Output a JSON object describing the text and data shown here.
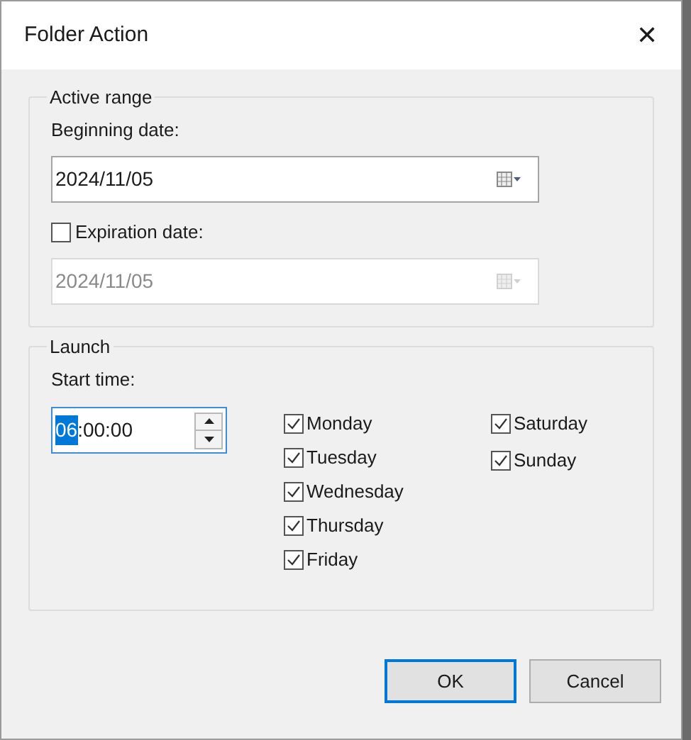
{
  "window": {
    "title": "Folder Action",
    "close": "✕"
  },
  "active_range": {
    "title": "Active range",
    "beginning": {
      "label": "Beginning date:",
      "value": "2024/11/05",
      "disabled": false
    },
    "expiration": {
      "label": "Expiration date:",
      "checked": false,
      "value": "2024/11/05",
      "disabled": true
    }
  },
  "launch": {
    "title": "Launch",
    "start_time": {
      "label": "Start time:",
      "parts": [
        {
          "text": "06",
          "selected": true
        },
        {
          "text": ":00:00",
          "selected": false
        }
      ]
    },
    "day_columns": [
      [
        {
          "label": "Monday",
          "checked": true
        },
        {
          "label": "Tuesday",
          "checked": true
        },
        {
          "label": "Wednesday",
          "checked": true
        },
        {
          "label": "Thursday",
          "checked": true
        },
        {
          "label": "Friday",
          "checked": true
        }
      ],
      [
        {
          "label": "Saturday",
          "checked": true
        },
        {
          "label": "Sunday",
          "checked": true
        }
      ]
    ]
  },
  "buttons": [
    {
      "label": "OK",
      "default": true
    },
    {
      "label": "Cancel",
      "default": false
    }
  ]
}
